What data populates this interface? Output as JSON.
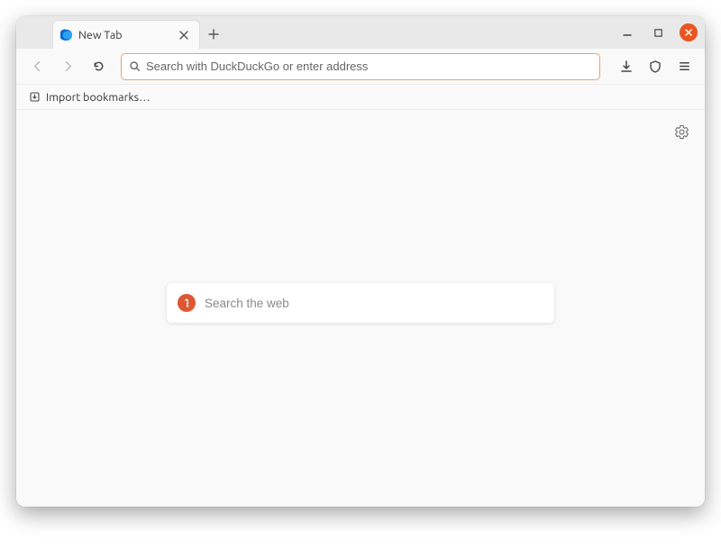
{
  "tab": {
    "title": "New Tab"
  },
  "urlbar": {
    "placeholder": "Search with DuckDuckGo or enter address"
  },
  "bookmarks": {
    "import_label": "Import bookmarks…"
  },
  "newtab_page": {
    "search_placeholder": "Search the web"
  }
}
